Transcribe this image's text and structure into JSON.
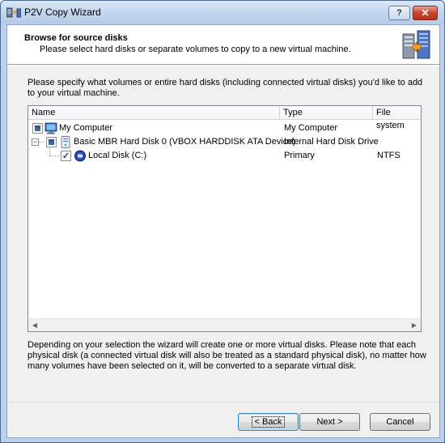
{
  "window": {
    "title": "P2V Copy Wizard",
    "help_label": "?",
    "close_label": "✕"
  },
  "header": {
    "title": "Browse for source disks",
    "subtitle": "Please select hard disks or separate volumes to copy to a new virtual machine."
  },
  "intro_text": "Please specify what volumes or entire hard disks (including connected virtual disks) you'd like to add to your virtual machine.",
  "tree": {
    "columns": [
      "Name",
      "Type",
      "File system"
    ],
    "rows": [
      {
        "name": "My Computer",
        "type": "My Computer",
        "fs": "",
        "check": "partial",
        "icon": "computer-icon"
      },
      {
        "name": "Basic MBR Hard Disk 0 (VBOX HARDDISK ATA Device)",
        "type": "Internal Hard Disk Drive",
        "fs": "",
        "check": "partial",
        "icon": "hard-disk-icon",
        "expander": "−"
      },
      {
        "name": "Local Disk (C:)",
        "type": "Primary",
        "fs": "NTFS",
        "check": "checked",
        "icon": "volume-icon"
      }
    ],
    "scroll_left": "◀",
    "scroll_right": "▶"
  },
  "footer_text": "Depending on your selection the wizard will create one or more virtual disks. Please note that each physical disk (a connected virtual disk will also be treated as a standard physical disk), no matter how many volumes have been selected on it, will be converted to a separate virtual disk.",
  "buttons": {
    "back": "< Back",
    "next": "Next >",
    "cancel": "Cancel"
  },
  "check_mark": "✓"
}
